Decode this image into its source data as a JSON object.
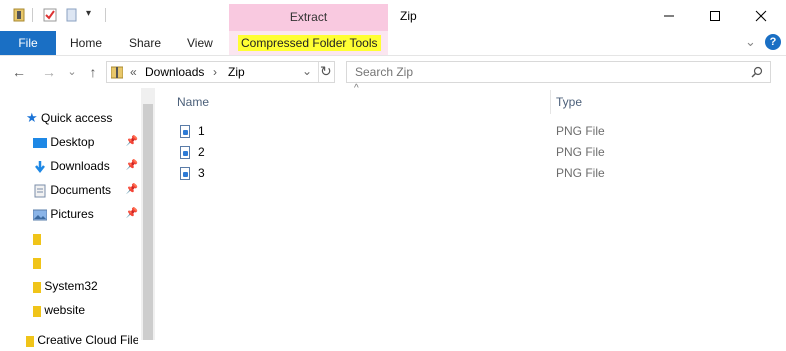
{
  "window": {
    "title": "Zip",
    "contextual_tab_group": "Extract",
    "controls": {
      "minimize": "—",
      "maximize": "☐",
      "close": "✕"
    }
  },
  "ribbon": {
    "file": "File",
    "tabs": [
      "Home",
      "Share",
      "View"
    ],
    "contextual_tab": "Compressed Folder Tools",
    "help": "?",
    "expand": "⌄"
  },
  "navigation": {
    "back": "←",
    "forward": "→",
    "recent": "⌄",
    "up": "↑",
    "breadcrumb_overflow": "«",
    "path": [
      "Downloads",
      "Zip"
    ],
    "separator": "›",
    "refresh": "↻",
    "dropdown": "⌄"
  },
  "search": {
    "placeholder": "Search Zip",
    "icon": "search-icon"
  },
  "sidebar": {
    "quick_access": "Quick access",
    "items": [
      {
        "label": "Desktop",
        "icon": "desktop-icon",
        "pinned": true
      },
      {
        "label": "Downloads",
        "icon": "downloads-icon",
        "pinned": true
      },
      {
        "label": "Documents",
        "icon": "documents-icon",
        "pinned": true
      },
      {
        "label": "Pictures",
        "icon": "pictures-icon",
        "pinned": true
      },
      {
        "label": "",
        "icon": "folder-icon",
        "pinned": false
      },
      {
        "label": "",
        "icon": "folder-icon",
        "pinned": false
      },
      {
        "label": "System32",
        "icon": "folder-icon",
        "pinned": false
      },
      {
        "label": "website",
        "icon": "folder-icon",
        "pinned": false
      }
    ],
    "partial_item": "Creative Cloud Files"
  },
  "file_list": {
    "columns": [
      "Name",
      "Type"
    ],
    "rows": [
      {
        "name": "1",
        "type": "PNG File"
      },
      {
        "name": "2",
        "type": "PNG File"
      },
      {
        "name": "3",
        "type": "PNG File"
      }
    ]
  },
  "colors": {
    "file_tab": "#1a6fc4",
    "extract_tab": "#f9c9e0",
    "highlight": "#ffff33"
  }
}
